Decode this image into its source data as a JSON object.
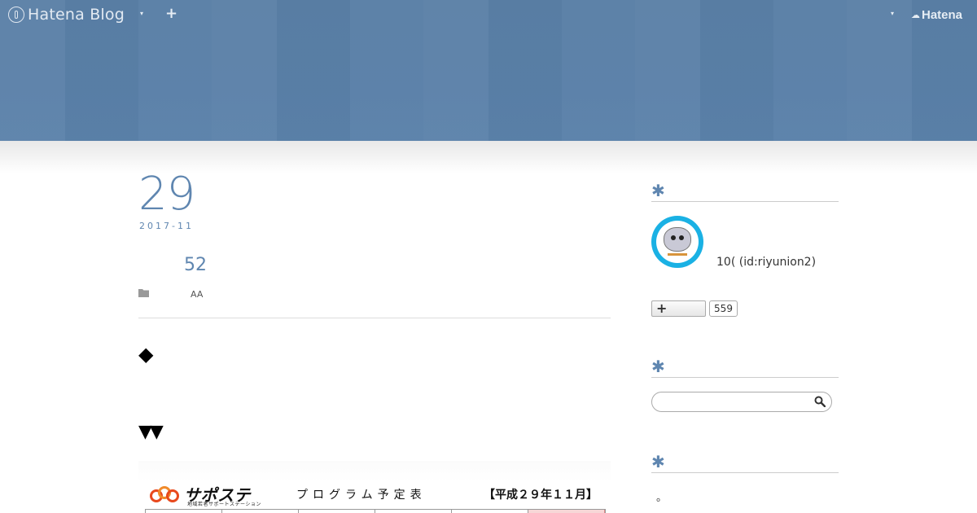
{
  "hatena_bar": {
    "blog_logo_text": "Hatena Blog",
    "menu_caret": "▾",
    "add_symbol": "+",
    "account_caret": "▾",
    "hatena_logo_text": "Hatena"
  },
  "entry": {
    "day": "29",
    "year_month": "2017-11",
    "title": "52",
    "category": "AA",
    "heading_1": "◆",
    "heading_2": "▼▼"
  },
  "schedule_image": {
    "logo_text": "サポステ",
    "logo_subtext": "地域若者サポートステーション",
    "title": "プログラム予定表",
    "month_label": "【平成２９年１１月】"
  },
  "sidebar": {
    "section_marker": "✱",
    "profile": {
      "id_text": "10(  (id:riyunion2)",
      "avatar_ring_text": ""
    },
    "reader": {
      "button_symbol": "+",
      "count": "559"
    },
    "search": {
      "placeholder": "",
      "value": ""
    },
    "footer_text": "。"
  },
  "colors": {
    "header_band": "#5a80a8",
    "accent": "#5f86b0"
  },
  "icons": [
    "hatena-blog-logo-icon",
    "chevron-down-icon",
    "plus-icon",
    "hatena-logo-icon",
    "folder-icon",
    "search-icon",
    "avatar"
  ]
}
